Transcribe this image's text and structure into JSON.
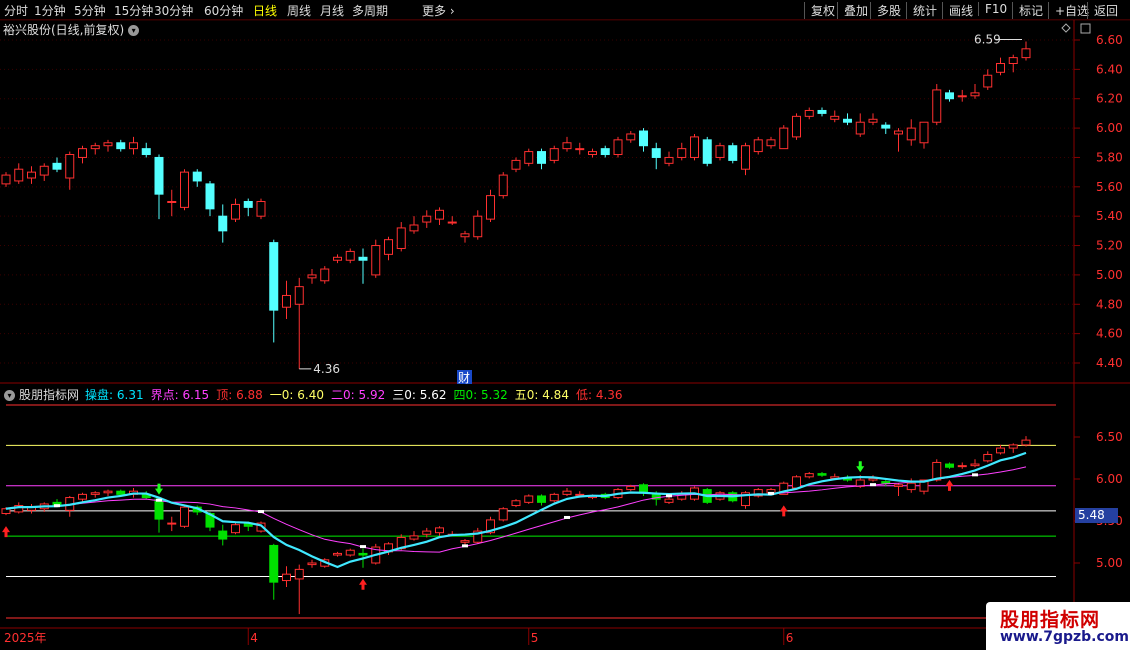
{
  "toolbar": {
    "periods": [
      "分时",
      "1分钟",
      "5分钟",
      "15分钟",
      "30分钟",
      "60分钟",
      "日线",
      "周线",
      "月线",
      "多周期"
    ],
    "active": "日线",
    "more": "更多",
    "right": [
      "复权",
      "叠加",
      "多股",
      "统计",
      "画线",
      "F10",
      "标记",
      "+自选",
      "返回"
    ]
  },
  "stock": {
    "title": "裕兴股份(日线,前复权)",
    "high_label": "6.59",
    "low_label": "4.36",
    "event_marker": "财"
  },
  "indicator": {
    "name": "股朋指标网",
    "values": [
      {
        "label": "操盘:",
        "value": "6.31",
        "color": "#00e5ff"
      },
      {
        "label": "界点:",
        "value": "6.15",
        "color": "#ff40ff"
      },
      {
        "label": "顶:",
        "value": "6.88",
        "color": "#ff3030"
      },
      {
        "label": "一0:",
        "value": "6.40",
        "color": "#ffff66"
      },
      {
        "label": "二0:",
        "value": "5.92",
        "color": "#ff40ff"
      },
      {
        "label": "三0:",
        "value": "5.62",
        "color": "#ffffff"
      },
      {
        "label": "四0:",
        "value": "5.32",
        "color": "#00ee00"
      },
      {
        "label": "五0:",
        "value": "4.84",
        "color": "#ffff66"
      },
      {
        "label": "低:",
        "value": "4.36",
        "color": "#ff3030"
      }
    ],
    "levels": [
      6.88,
      6.4,
      5.92,
      5.62,
      5.32,
      4.84,
      4.36
    ],
    "level_colors": [
      "#ff3030",
      "#ffff66",
      "#ff40ff",
      "#ffffff",
      "#00ee00",
      "#ffffff",
      "#ff3030"
    ],
    "current_price": "5.48",
    "buy_arrows": [
      0,
      28,
      61,
      74
    ],
    "sell_arrows": [
      12,
      67
    ]
  },
  "axes": {
    "main_ticks": [
      "6.60",
      "6.40",
      "6.20",
      "6.00",
      "5.80",
      "5.60",
      "5.40",
      "5.20",
      "5.00",
      "4.80",
      "4.60",
      "4.40"
    ],
    "ind_ticks": [
      "6.50",
      "6.00",
      "5.50",
      "5.00"
    ],
    "x_labels": [
      {
        "text": "2025年",
        "index": 0
      },
      {
        "text": "4",
        "index": 19
      },
      {
        "text": "5",
        "index": 41
      },
      {
        "text": "6",
        "index": 61
      }
    ]
  },
  "watermark": {
    "brand": "股朋指标网",
    "url": "www.7gpzb.com"
  },
  "chart_data": {
    "type": "candlestick",
    "ylim": [
      4.3,
      6.66
    ],
    "ohlc": [
      [
        5.62,
        5.7,
        5.6,
        5.68
      ],
      [
        5.64,
        5.76,
        5.62,
        5.72
      ],
      [
        5.66,
        5.74,
        5.62,
        5.7
      ],
      [
        5.68,
        5.76,
        5.64,
        5.74
      ],
      [
        5.76,
        5.8,
        5.7,
        5.72
      ],
      [
        5.66,
        5.84,
        5.58,
        5.82
      ],
      [
        5.8,
        5.88,
        5.76,
        5.86
      ],
      [
        5.86,
        5.9,
        5.82,
        5.88
      ],
      [
        5.88,
        5.92,
        5.84,
        5.9
      ],
      [
        5.9,
        5.92,
        5.84,
        5.86
      ],
      [
        5.86,
        5.94,
        5.82,
        5.9
      ],
      [
        5.86,
        5.9,
        5.8,
        5.82
      ],
      [
        5.8,
        5.82,
        5.38,
        5.55
      ],
      [
        5.5,
        5.58,
        5.4,
        5.5
      ],
      [
        5.46,
        5.72,
        5.44,
        5.7
      ],
      [
        5.7,
        5.72,
        5.6,
        5.64
      ],
      [
        5.62,
        5.64,
        5.4,
        5.45
      ],
      [
        5.4,
        5.48,
        5.22,
        5.3
      ],
      [
        5.38,
        5.52,
        5.36,
        5.48
      ],
      [
        5.5,
        5.52,
        5.4,
        5.46
      ],
      [
        5.4,
        5.52,
        5.38,
        5.5
      ],
      [
        5.22,
        5.24,
        4.54,
        4.76
      ],
      [
        4.78,
        4.96,
        4.7,
        4.86
      ],
      [
        4.8,
        4.98,
        4.36,
        4.92
      ],
      [
        4.98,
        5.04,
        4.94,
        5.0
      ],
      [
        4.96,
        5.06,
        4.94,
        5.04
      ],
      [
        5.1,
        5.14,
        5.08,
        5.12
      ],
      [
        5.1,
        5.18,
        5.08,
        5.16
      ],
      [
        5.12,
        5.18,
        4.94,
        5.1
      ],
      [
        5.0,
        5.24,
        4.98,
        5.2
      ],
      [
        5.14,
        5.26,
        5.1,
        5.24
      ],
      [
        5.18,
        5.36,
        5.16,
        5.32
      ],
      [
        5.3,
        5.4,
        5.28,
        5.34
      ],
      [
        5.36,
        5.44,
        5.32,
        5.4
      ],
      [
        5.38,
        5.46,
        5.34,
        5.44
      ],
      [
        5.36,
        5.4,
        5.34,
        5.36
      ],
      [
        5.26,
        5.3,
        5.22,
        5.28
      ],
      [
        5.26,
        5.44,
        5.24,
        5.4
      ],
      [
        5.38,
        5.58,
        5.36,
        5.54
      ],
      [
        5.54,
        5.7,
        5.52,
        5.68
      ],
      [
        5.72,
        5.8,
        5.7,
        5.78
      ],
      [
        5.76,
        5.86,
        5.74,
        5.84
      ],
      [
        5.84,
        5.86,
        5.72,
        5.76
      ],
      [
        5.78,
        5.88,
        5.76,
        5.86
      ],
      [
        5.86,
        5.94,
        5.84,
        5.9
      ],
      [
        5.86,
        5.9,
        5.82,
        5.86
      ],
      [
        5.82,
        5.86,
        5.8,
        5.84
      ],
      [
        5.86,
        5.88,
        5.8,
        5.82
      ],
      [
        5.82,
        5.94,
        5.8,
        5.92
      ],
      [
        5.92,
        5.98,
        5.9,
        5.96
      ],
      [
        5.98,
        6.0,
        5.84,
        5.88
      ],
      [
        5.86,
        5.9,
        5.72,
        5.8
      ],
      [
        5.76,
        5.84,
        5.74,
        5.8
      ],
      [
        5.8,
        5.9,
        5.78,
        5.86
      ],
      [
        5.8,
        5.96,
        5.78,
        5.94
      ],
      [
        5.92,
        5.94,
        5.74,
        5.76
      ],
      [
        5.8,
        5.9,
        5.78,
        5.88
      ],
      [
        5.88,
        5.9,
        5.76,
        5.78
      ],
      [
        5.72,
        5.9,
        5.68,
        5.88
      ],
      [
        5.84,
        5.94,
        5.82,
        5.92
      ],
      [
        5.88,
        5.94,
        5.86,
        5.92
      ],
      [
        5.86,
        6.02,
        5.86,
        6.0
      ],
      [
        5.94,
        6.1,
        5.92,
        6.08
      ],
      [
        6.08,
        6.14,
        6.06,
        6.12
      ],
      [
        6.12,
        6.14,
        6.08,
        6.1
      ],
      [
        6.06,
        6.12,
        6.04,
        6.08
      ],
      [
        6.06,
        6.1,
        6.02,
        6.04
      ],
      [
        5.96,
        6.1,
        5.94,
        6.04
      ],
      [
        6.04,
        6.1,
        6.02,
        6.06
      ],
      [
        6.02,
        6.04,
        5.96,
        6.0
      ],
      [
        5.96,
        6.0,
        5.84,
        5.98
      ],
      [
        5.92,
        6.06,
        5.88,
        6.0
      ],
      [
        5.9,
        6.02,
        5.86,
        6.04
      ],
      [
        6.04,
        6.3,
        6.02,
        6.26
      ],
      [
        6.24,
        6.26,
        6.18,
        6.2
      ],
      [
        6.22,
        6.26,
        6.18,
        6.22
      ],
      [
        6.22,
        6.3,
        6.2,
        6.24
      ],
      [
        6.28,
        6.4,
        6.26,
        6.36
      ],
      [
        6.38,
        6.48,
        6.36,
        6.44
      ],
      [
        6.44,
        6.5,
        6.38,
        6.48
      ],
      [
        6.48,
        6.59,
        6.46,
        6.54
      ]
    ]
  }
}
